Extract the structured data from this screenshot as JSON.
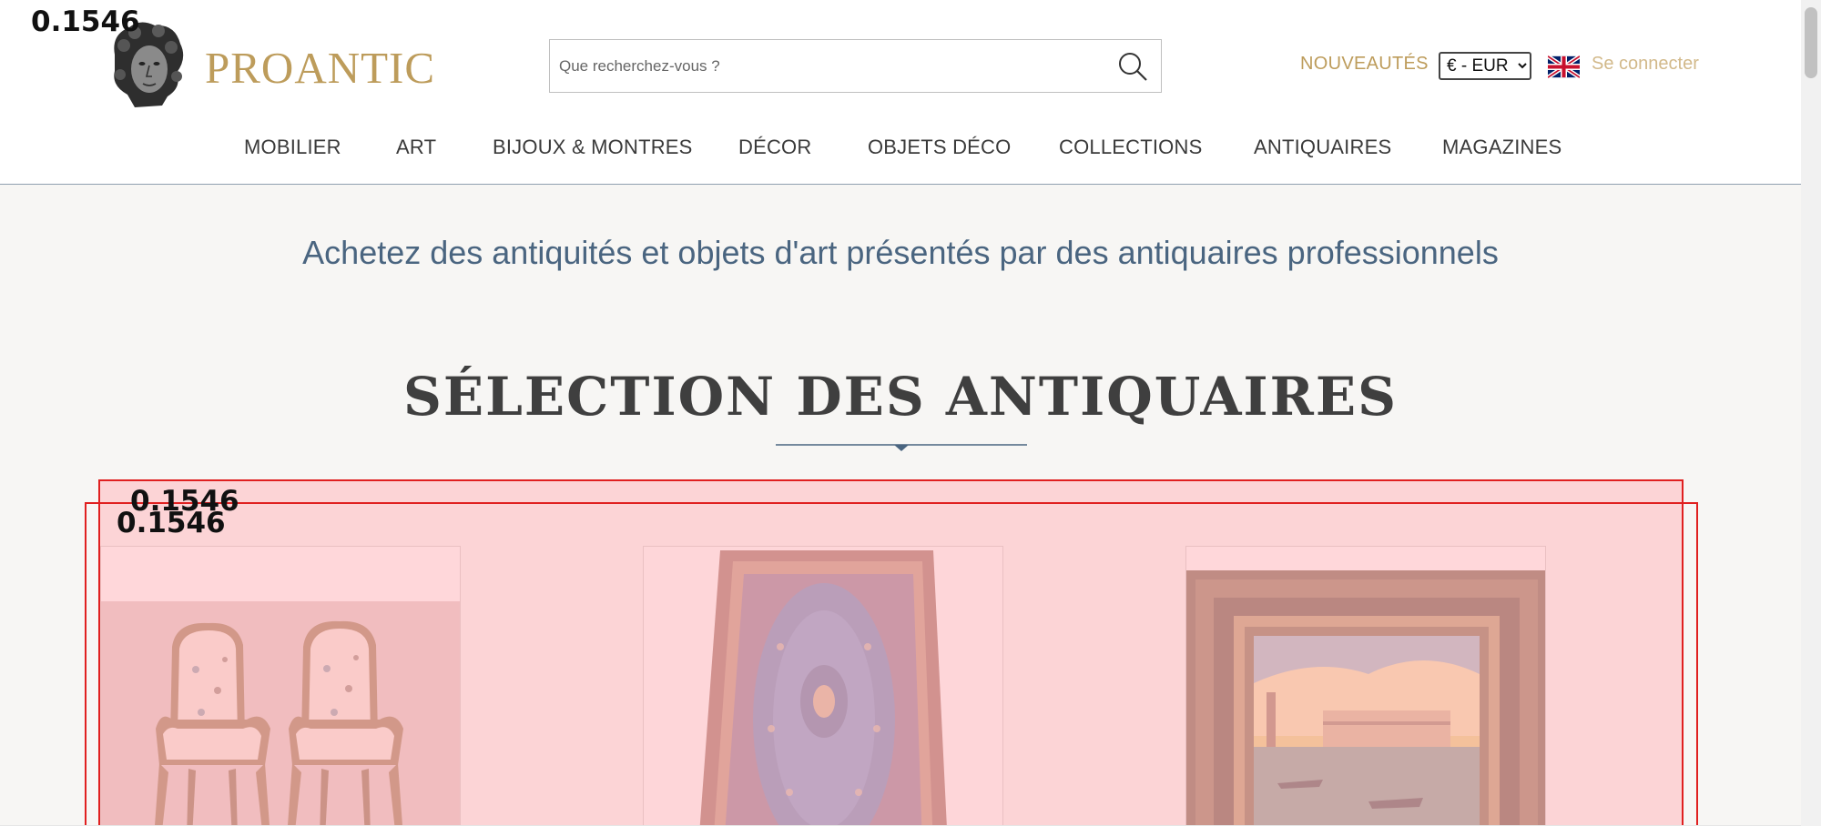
{
  "header": {
    "logo_text": "PROANTIC",
    "search_placeholder": "Que recherchez-vous ?",
    "new_label": "NOUVEAUTÉS",
    "currency_options": [
      "€ - EUR"
    ],
    "currency_selected": "€ - EUR",
    "login_label": "Se connecter"
  },
  "nav": {
    "items": [
      "MOBILIER",
      "ART",
      "BIJOUX & MONTRES",
      "DÉCOR",
      "OBJETS DÉCO",
      "COLLECTIONS",
      "ANTIQUAIRES",
      "MAGAZINES"
    ]
  },
  "hero": {
    "tagline": "Achetez des antiquités et objets d'art présentés par des antiquaires professionnels",
    "section_title": "SÉLECTION DES ANTIQUAIRES"
  },
  "products": [
    {
      "image": "pair-of-armchairs"
    },
    {
      "image": "persian-silk-rug"
    },
    {
      "image": "framed-venice-painting"
    }
  ],
  "overlay_scores": [
    "0.1546",
    "0.1546",
    "0.1546"
  ],
  "colors": {
    "brand_gold": "#bd9c5b",
    "tagline_blue": "#4a6580",
    "overlay_red": "#e02020"
  }
}
